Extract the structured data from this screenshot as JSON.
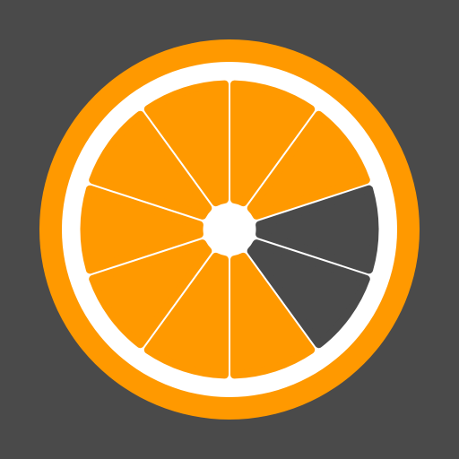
{
  "icon": {
    "name": "orange-slice-icon",
    "colors": {
      "background": "#4a4a4a",
      "rind": "#ff9900",
      "pith": "#ffffff",
      "segment_filled": "#ff9900",
      "segment_empty": "#4a4a4a"
    },
    "segments_total": 10,
    "segments_filled": 8,
    "segments_empty": 2
  }
}
